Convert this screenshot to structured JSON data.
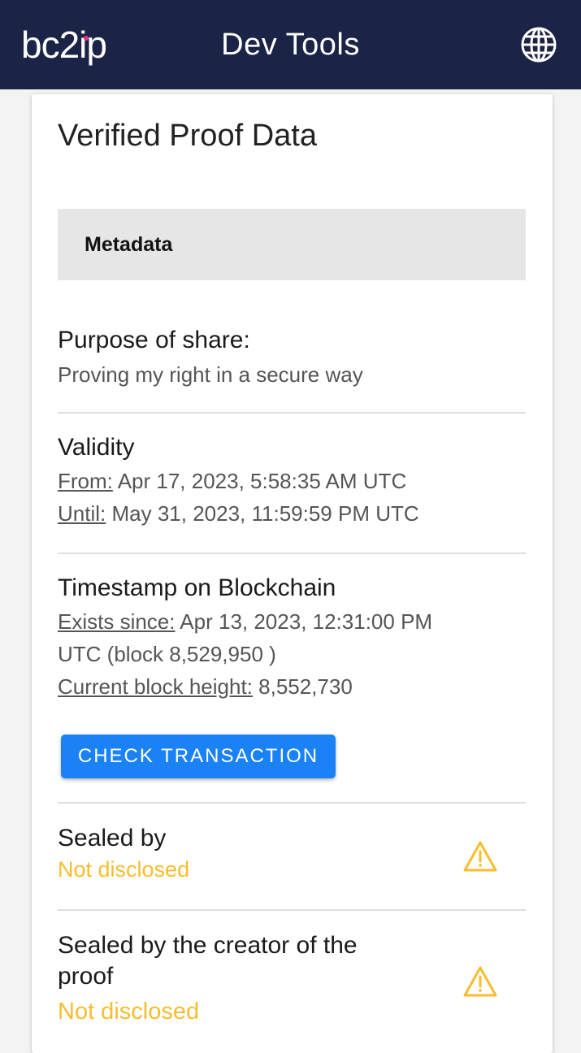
{
  "appbar": {
    "logo_text": "bc2ip",
    "title": "Dev Tools",
    "globe_icon": "globe-icon"
  },
  "card": {
    "title": "Verified Proof Data",
    "metadata_label": "Metadata",
    "purpose": {
      "title": "Purpose of share:",
      "value": "Proving my right in a secure way"
    },
    "validity": {
      "title": "Validity",
      "from_label": "From:",
      "from_value": "Apr 17, 2023, 5:58:35 AM UTC",
      "until_label": "Until:",
      "until_value": "May 31, 2023, 11:59:59 PM UTC"
    },
    "timestamp": {
      "title": "Timestamp on Blockchain",
      "exists_label": "Exists since:",
      "exists_value_line1": "Apr 13, 2023, 12:31:00 PM",
      "exists_value_line2": "UTC (block 8,529,950 )",
      "height_label": "Current block height:",
      "height_value": "8,552,730"
    },
    "check_button": "CHECK TRANSACTION",
    "sealed_by": {
      "title": "Sealed by",
      "status": "Not disclosed"
    },
    "sealed_by_creator": {
      "title_line1": "Sealed by the creator of the",
      "title_line2": "proof",
      "status": "Not disclosed"
    },
    "colors": {
      "appbar": "#1b2346",
      "button": "#1a82f5",
      "warning": "#f7bd2d"
    }
  }
}
